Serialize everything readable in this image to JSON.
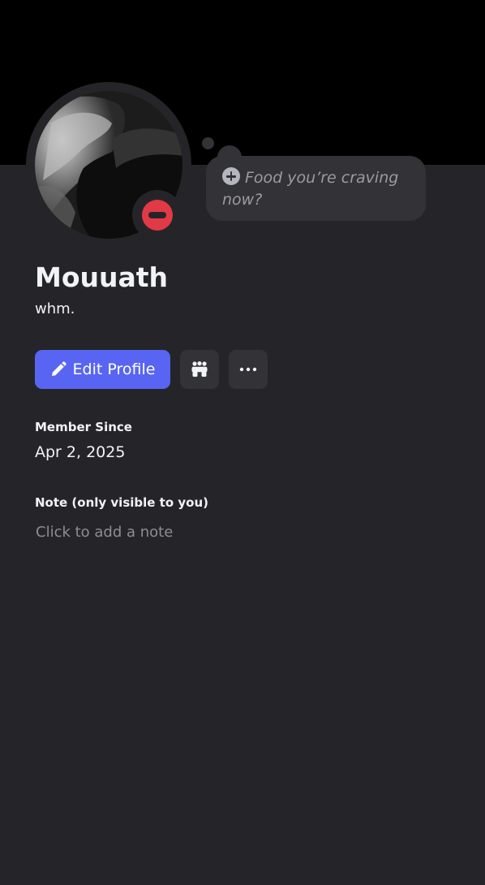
{
  "profile": {
    "display_name": "Mouuath",
    "username": "whm.",
    "status": "do-not-disturb",
    "avatar_icon": "avatar-photo"
  },
  "custom_status": {
    "placeholder": "Food you’re craving now?",
    "icon": "plus-circle-icon"
  },
  "actions": {
    "edit_profile_label": "Edit Profile",
    "edit_icon": "pencil-icon",
    "friends_icon": "friends-icon",
    "more_icon": "more-icon"
  },
  "member_since": {
    "label": "Member Since",
    "value": "Apr 2, 2025"
  },
  "note": {
    "label": "Note (only visible to you)",
    "placeholder": "Click to add a note"
  },
  "colors": {
    "background": "#252529",
    "banner": "#000000",
    "accent": "#5865f2",
    "dnd": "#e13a45",
    "button_secondary": "#323237"
  }
}
